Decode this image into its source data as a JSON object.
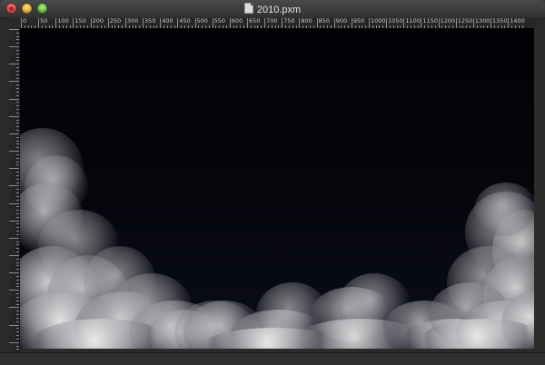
{
  "window": {
    "title": "2010.pxm",
    "title_icon": "document-icon",
    "buttons": [
      "close",
      "minimize",
      "zoom"
    ]
  },
  "ruler": {
    "horizontal_labels": [
      "0",
      "50",
      "100",
      "150",
      "200",
      "250",
      "300",
      "350",
      "400",
      "450",
      "500",
      "550",
      "600",
      "650",
      "700",
      "750",
      "800",
      "850",
      "900",
      "950",
      "1000",
      "1050",
      "1100",
      "1150",
      "1200",
      "1250",
      "1300",
      "1350",
      "1400"
    ]
  },
  "canvas": {
    "background_top": "#020205",
    "background_bottom": "#0b0d18",
    "content": "clouds-image"
  }
}
